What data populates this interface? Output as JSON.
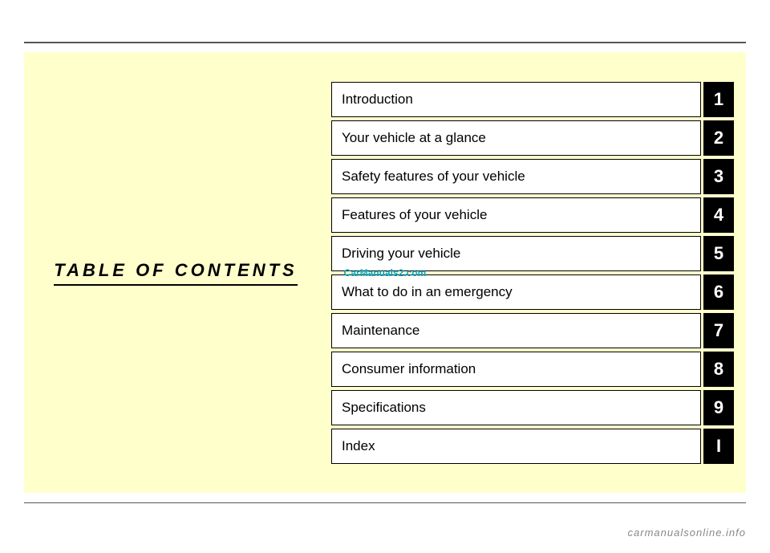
{
  "page": {
    "title": "TABLE OF CONTENTS",
    "watermark": "CarManuals2.com",
    "footer": "carmanualsonline.info"
  },
  "toc": {
    "items": [
      {
        "label": "Introduction",
        "number": "1"
      },
      {
        "label": "Your vehicle at a glance",
        "number": "2"
      },
      {
        "label": "Safety features of your vehicle",
        "number": "3"
      },
      {
        "label": "Features of your vehicle",
        "number": "4"
      },
      {
        "label": "Driving your vehicle",
        "number": "5"
      },
      {
        "label": "What to do in an emergency",
        "number": "6"
      },
      {
        "label": "Maintenance",
        "number": "7"
      },
      {
        "label": "Consumer information",
        "number": "8"
      },
      {
        "label": "Specifications",
        "number": "9"
      },
      {
        "label": "Index",
        "number": "I"
      }
    ]
  }
}
